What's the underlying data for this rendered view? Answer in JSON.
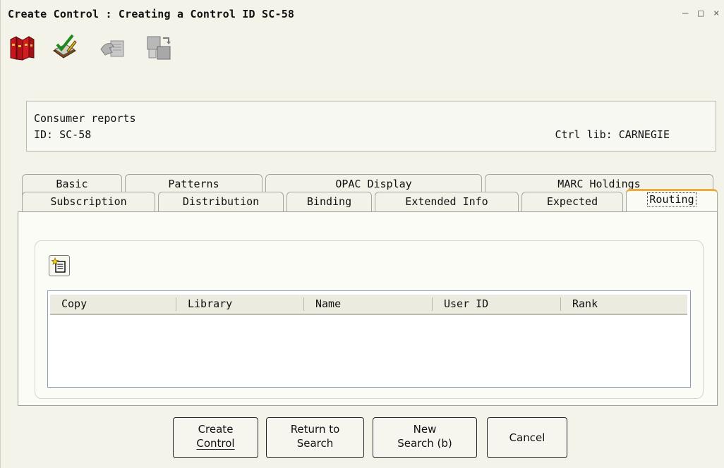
{
  "window": {
    "title": "Create Control : Creating a Control ID SC-58",
    "minimize_glyph": "–",
    "maximize_glyph": "□",
    "close_glyph": "×"
  },
  "toolbar": {
    "icons": [
      "books-icon",
      "checklist-edit-icon",
      "hand-card-icon",
      "copy-arrange-icon"
    ]
  },
  "info": {
    "title": "Consumer reports",
    "id_text": "ID: SC-58",
    "ctrl_lib_text": "Ctrl lib: CARNEGIE"
  },
  "tabs": {
    "row1": [
      "Basic",
      "Patterns",
      "OPAC Display",
      "MARC Holdings"
    ],
    "row2": [
      "Subscription",
      "Distribution",
      "Binding",
      "Extended Info",
      "Expected",
      "Routing"
    ],
    "active": "Routing"
  },
  "routing": {
    "add_icon": "add-document-icon",
    "columns": [
      "Copy",
      "Library",
      "Name",
      "User ID",
      "Rank"
    ],
    "rows": []
  },
  "buttons": {
    "create": {
      "line1": "Create",
      "line2": "Control"
    },
    "return": {
      "line1": "Return to",
      "line2": "Search"
    },
    "new_search": {
      "line1": "New",
      "line2": "Search (b)"
    },
    "cancel": {
      "line1": "Cancel"
    }
  },
  "colors": {
    "background": "#f3f3e9",
    "active_tab_accent": "#f2a93b",
    "grid_border": "#8aa0b4"
  }
}
